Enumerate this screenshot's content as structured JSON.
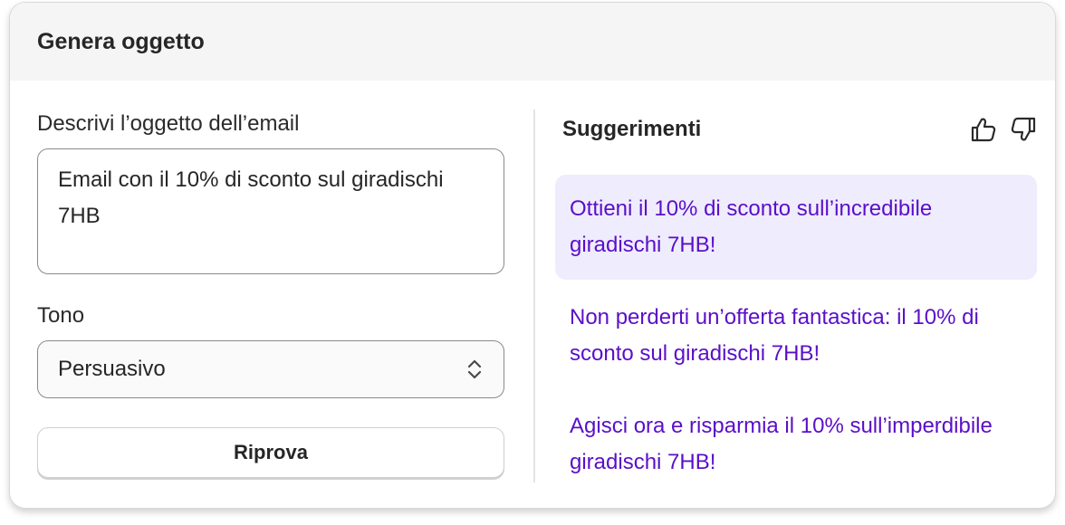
{
  "header": {
    "title": "Genera oggetto"
  },
  "form": {
    "subject_label": "Descrivi l’oggetto dell’email",
    "subject_value": "Email con il 10% di sconto sul giradischi 7HB",
    "tone_label": "Tono",
    "tone_selected": "Persuasivo",
    "retry_label": "Riprova"
  },
  "suggestions": {
    "title": "Suggerimenti",
    "items": [
      {
        "text": "Ottieni il 10% di sconto sull’incredibile giradischi 7HB!"
      },
      {
        "text": "Non perderti un’offerta fantastica: il 10% di sconto sul giradischi 7HB!"
      },
      {
        "text": "Agisci ora e risparmia il 10% sull’imperdibile giradischi 7HB!"
      }
    ],
    "icons": [
      "thumbs-up-icon",
      "thumbs-down-icon"
    ]
  },
  "colors": {
    "suggestion_text": "#5a0fc8",
    "selected_bg": "#efecfd",
    "header_bg": "#f5f5f5"
  }
}
